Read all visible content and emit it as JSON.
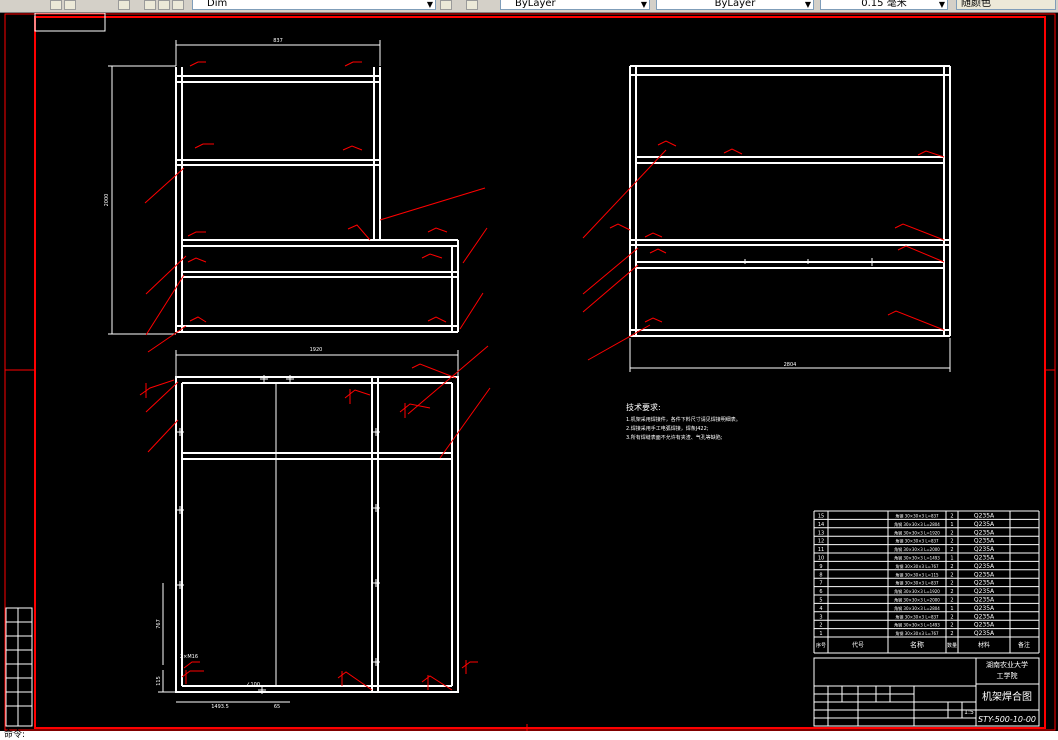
{
  "toolbar": {
    "layer_name": "Dim",
    "color_value": "ByLayer",
    "linetype_value": "ByLayer",
    "lineweight_value": "0.15 毫米",
    "plotstyle_value": "随颜色"
  },
  "drawing": {
    "dims": {
      "top_width": "837",
      "height": "2000",
      "side_width": "2804",
      "front_width": "1920",
      "bottom_dim1": "1493.5",
      "bottom_dim2": "65",
      "vert_dim1": "767",
      "vert_dim2": "115",
      "note_a": "2×M16",
      "note_b": "∠100"
    },
    "tech_title": "技术要求:",
    "tech_items": [
      "1.机架采用焊接件，各件下料尺寸请见焊接明细表。",
      "2.焊接采用手工电弧焊接，焊条J422;",
      "3.所有焊缝表面不允许有夹渣、气孔等缺陷;"
    ],
    "bom_rows": [
      {
        "no": "15",
        "name": "角钢 30×30×3 L=837",
        "qty": "2",
        "mat": "Q235A"
      },
      {
        "no": "14",
        "name": "角钢 30×30×3 L=2804",
        "qty": "1",
        "mat": "Q235A"
      },
      {
        "no": "13",
        "name": "角钢 30×30×3 L=1920",
        "qty": "2",
        "mat": "Q235A"
      },
      {
        "no": "12",
        "name": "角钢 30×30×3 L=837",
        "qty": "2",
        "mat": "Q235A"
      },
      {
        "no": "11",
        "name": "角钢 30×30×3 L=2000",
        "qty": "2",
        "mat": "Q235A"
      },
      {
        "no": "10",
        "name": "角钢 30×30×3 L=1493",
        "qty": "1",
        "mat": "Q235A"
      },
      {
        "no": "9",
        "name": "角钢 30×30×3 L=767",
        "qty": "2",
        "mat": "Q235A"
      },
      {
        "no": "8",
        "name": "角钢 30×30×3 L=115",
        "qty": "2",
        "mat": "Q235A"
      },
      {
        "no": "7",
        "name": "角钢 30×30×3 L=837",
        "qty": "2",
        "mat": "Q235A"
      },
      {
        "no": "6",
        "name": "角钢 30×30×3 L=1920",
        "qty": "2",
        "mat": "Q235A"
      },
      {
        "no": "5",
        "name": "角钢 30×30×3 L=2000",
        "qty": "2",
        "mat": "Q235A"
      },
      {
        "no": "4",
        "name": "角钢 30×30×3 L=2804",
        "qty": "1",
        "mat": "Q235A"
      },
      {
        "no": "3",
        "name": "角钢 30×30×3 L=837",
        "qty": "2",
        "mat": "Q235A"
      },
      {
        "no": "2",
        "name": "角钢 30×30×3 L=1493",
        "qty": "2",
        "mat": "Q235A"
      },
      {
        "no": "1",
        "name": "角钢 30×30×3 L=767",
        "qty": "2",
        "mat": "Q235A"
      }
    ],
    "bom_header": {
      "no": "序号",
      "code": "代号",
      "name": "名称",
      "qty": "数量",
      "mat": "材料",
      "note": "备注"
    },
    "title_block": {
      "org_line1": "湖南农业大学",
      "org_line2": "工学院",
      "drawing_title": "机架焊合图",
      "drawing_code": "STY-500-10-00",
      "scale": "1:5"
    }
  },
  "status": {
    "text": "命令: "
  }
}
